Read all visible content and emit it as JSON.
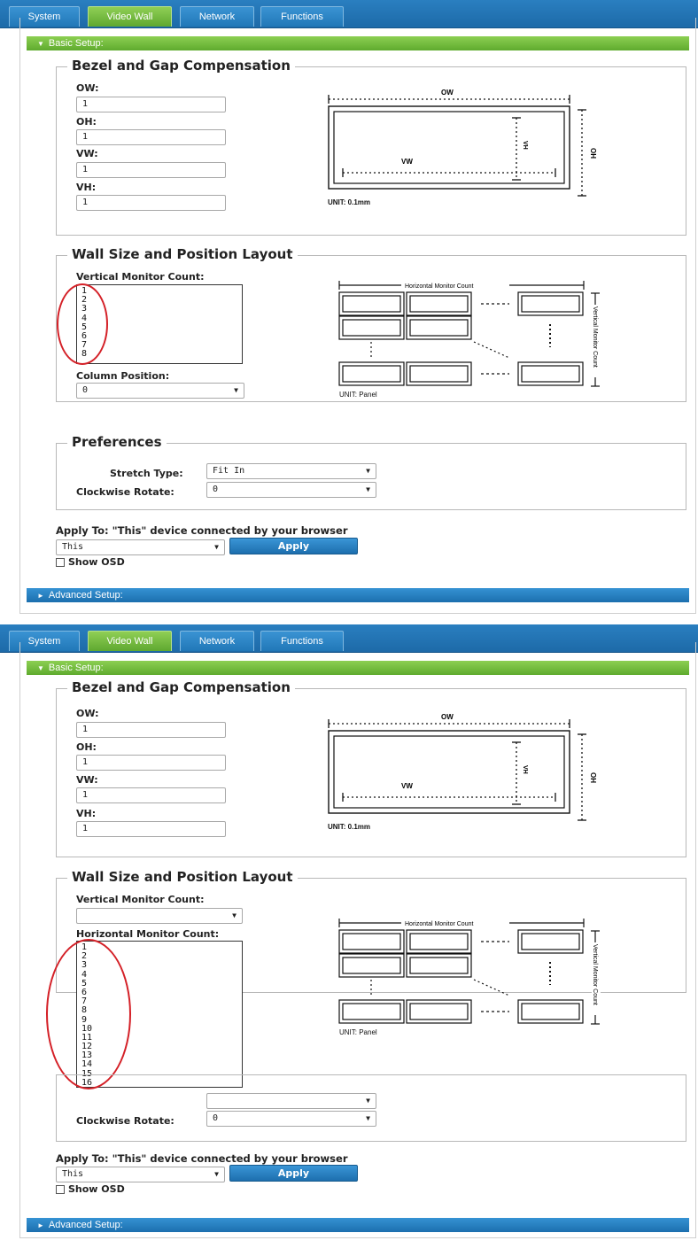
{
  "tabs": [
    {
      "label": "System",
      "active": false
    },
    {
      "label": "Video Wall",
      "active": true
    },
    {
      "label": "Network",
      "active": false
    },
    {
      "label": "Functions",
      "active": false
    }
  ],
  "basic_setup_label": "Basic Setup:",
  "advanced_setup_label": "Advanced Setup:",
  "bezel": {
    "legend": "Bezel and Gap Compensation",
    "ow_label": "OW:",
    "ow_value": "1",
    "oh_label": "OH:",
    "oh_value": "1",
    "vw_label": "VW:",
    "vw_value": "1",
    "vh_label": "VH:",
    "vh_value": "1",
    "diagram": {
      "ow": "OW",
      "oh": "OH",
      "vw": "VW",
      "vh": "VH",
      "unit": "UNIT: 0.1mm"
    }
  },
  "wall": {
    "legend": "Wall Size and Position Layout",
    "vertical_count_label": "Vertical Monitor Count:",
    "horizontal_count_label": "Horizontal Monitor Count:",
    "column_position_label": "Column Position:",
    "column_position_value": "0",
    "vertical_options": [
      "1",
      "2",
      "3",
      "4",
      "5",
      "6",
      "7",
      "8"
    ],
    "horizontal_options": [
      "1",
      "2",
      "3",
      "4",
      "5",
      "6",
      "7",
      "8",
      "9",
      "10",
      "11",
      "12",
      "13",
      "14",
      "15",
      "16"
    ],
    "diagram": {
      "horizontal": "Horizontal Monitor Count",
      "vertical": "Vertical Monitor Count",
      "unit": "UNIT: Panel"
    }
  },
  "preferences": {
    "legend": "Preferences",
    "stretch_label": "Stretch Type:",
    "stretch_value": "Fit In",
    "rotate_label": "Clockwise Rotate:",
    "rotate_value": "0"
  },
  "apply": {
    "heading": "Apply To: \"This\" device connected by your browser",
    "target_value": "This",
    "button_label": "Apply",
    "show_osd_label": "Show OSD"
  },
  "colors": {
    "tab_blue": "#1d6aa8",
    "tab_green": "#5fa830",
    "highlight": "#d42027"
  }
}
